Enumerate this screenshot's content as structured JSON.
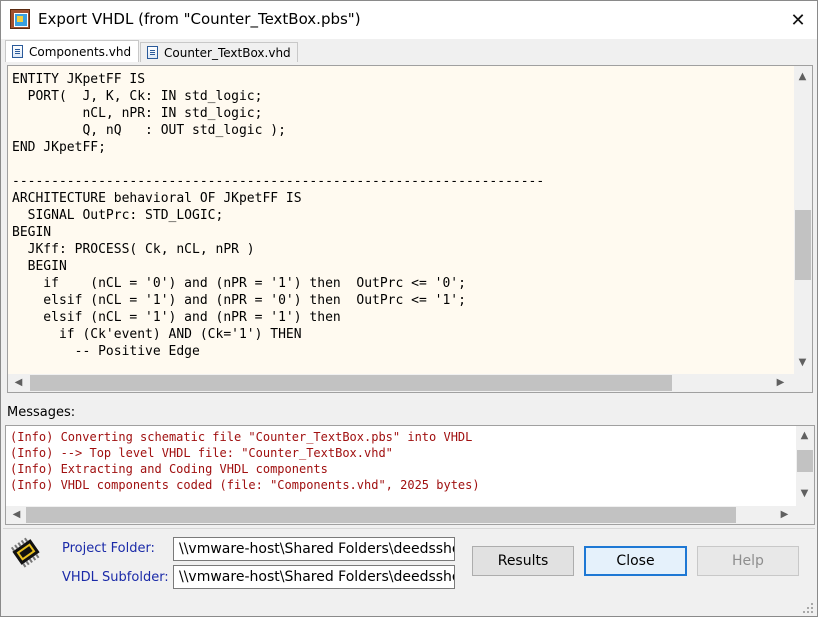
{
  "window": {
    "title": "Export VHDL (from \"Counter_TextBox.pbs\")",
    "close_glyph": "✕"
  },
  "tabs": [
    {
      "label": "Components.vhd",
      "active": true
    },
    {
      "label": "Counter_TextBox.vhd",
      "active": false
    }
  ],
  "code": {
    "text": "ENTITY JKpetFF IS\n  PORT(  J, K, Ck: IN std_logic;\n         nCL, nPR: IN std_logic;\n         Q, nQ   : OUT std_logic );\nEND JKpetFF;\n\n--------------------------------------------------------------------\nARCHITECTURE behavioral OF JKpetFF IS\n  SIGNAL OutPrc: STD_LOGIC;\nBEGIN\n  JKff: PROCESS( Ck, nCL, nPR )\n  BEGIN\n    if    (nCL = '0') and (nPR = '1') then  OutPrc <= '0';\n    elsif (nCL = '1') and (nPR = '0') then  OutPrc <= '1';\n    elsif (nCL = '1') and (nPR = '1') then\n      if (Ck'event) AND (Ck='1') THEN\n        -- Positive Edge",
    "background": "#fffaf0"
  },
  "messages": {
    "label": "Messages:",
    "text": "(Info) Converting schematic file \"Counter_TextBox.pbs\" into VHDL\n(Info) --> Top level VHDL file: \"Counter_TextBox.vhd\"\n(Info) Extracting and Coding VHDL components\n(Info) VHDL components coded (file: \"Components.vhd\", 2025 bytes)",
    "color": "#a01010"
  },
  "fields": {
    "project_folder_label": "Project Folder:",
    "project_folder_value": "\\\\vmware-host\\Shared Folders\\deedsshots\\D",
    "vhdl_subfolder_label": "VHDL Subfolder:",
    "vhdl_subfolder_value": "\\\\vmware-host\\Shared Folders\\deedsshots\\D",
    "label_color": "#1a2aa8"
  },
  "buttons": {
    "results": "Results",
    "close": "Close",
    "help": "Help"
  },
  "icons": {
    "app": "deeds-app-icon",
    "tab_doc": "document-icon",
    "logo": "deeds-chip-logo",
    "scroll_up": "▲",
    "scroll_down": "▼",
    "scroll_left": "◀",
    "scroll_right": "▶"
  },
  "colors": {
    "accent": "#1e78d4"
  }
}
